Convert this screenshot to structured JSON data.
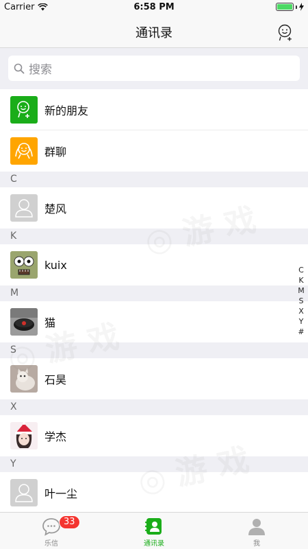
{
  "status_bar": {
    "carrier": "Carrier",
    "time": "6:58 PM",
    "battery_level": 1.0
  },
  "nav": {
    "title": "通讯录",
    "add_friend_icon": "add-friend-icon"
  },
  "search": {
    "placeholder": "搜索"
  },
  "top_items": [
    {
      "label": "新的朋友",
      "icon": "new-friends-icon",
      "color": "#1aad19"
    },
    {
      "label": "群聊",
      "icon": "group-chat-icon",
      "color": "#ffa500"
    }
  ],
  "sections": [
    {
      "letter": "C",
      "contacts": [
        {
          "name": "楚风",
          "avatar": "default-avatar"
        }
      ]
    },
    {
      "letter": "K",
      "contacts": [
        {
          "name": "kuix",
          "avatar": "cartoon-face-avatar"
        }
      ]
    },
    {
      "letter": "M",
      "contacts": [
        {
          "name": "猫",
          "avatar": "speaker-photo-avatar"
        }
      ]
    },
    {
      "letter": "S",
      "contacts": [
        {
          "name": "石昊",
          "avatar": "cat-photo-avatar"
        }
      ]
    },
    {
      "letter": "X",
      "contacts": [
        {
          "name": "学杰",
          "avatar": "girl-photo-avatar"
        }
      ]
    },
    {
      "letter": "Y",
      "contacts": [
        {
          "name": "叶一尘",
          "avatar": "default-avatar"
        }
      ]
    }
  ],
  "index_letters": [
    "C",
    "K",
    "M",
    "S",
    "X",
    "Y",
    "#"
  ],
  "tabs": [
    {
      "label": "乐信",
      "icon": "chat-bubble-icon",
      "badge": "33",
      "active": false
    },
    {
      "label": "通讯录",
      "icon": "contacts-icon",
      "active": true
    },
    {
      "label": "我",
      "icon": "profile-icon",
      "active": false
    }
  ],
  "colors": {
    "accent": "#1aad19",
    "badge": "#f43530",
    "section_bg": "#efeff4"
  }
}
